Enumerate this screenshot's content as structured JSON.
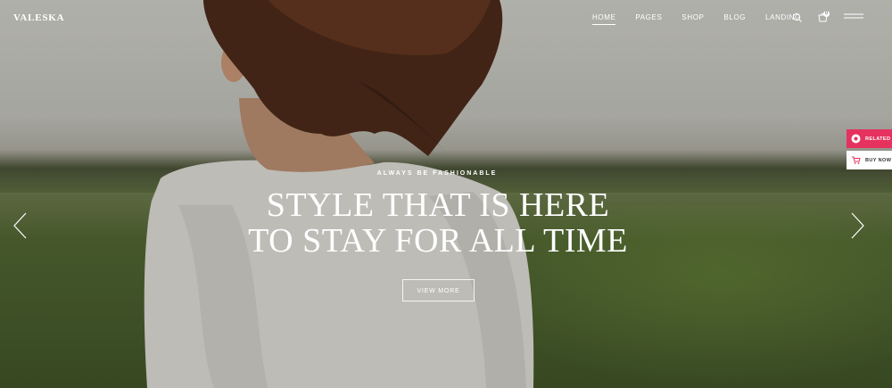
{
  "brand": {
    "logo": "VALESKA"
  },
  "nav": {
    "items": [
      {
        "label": "HOME",
        "active": true
      },
      {
        "label": "PAGES",
        "active": false
      },
      {
        "label": "SHOP",
        "active": false
      },
      {
        "label": "BLOG",
        "active": false
      },
      {
        "label": "LANDING",
        "active": false
      }
    ],
    "cart_count": "0"
  },
  "hero": {
    "eyebrow": "ALWAYS BE FASHIONABLE",
    "headline_line1": "STYLE THAT IS HERE",
    "headline_line2": "TO STAY FOR ALL TIME",
    "cta_label": "VIEW MORE"
  },
  "side": {
    "related_label": "RELATED",
    "buy_now_label": "BUY NOW"
  },
  "colors": {
    "accent": "#e5325e",
    "text_light": "#ffffff"
  },
  "icons": [
    "search-icon",
    "cart-icon",
    "menu-icon",
    "chevron-left-icon",
    "chevron-right-icon",
    "related-icon",
    "cart-small-icon"
  ]
}
